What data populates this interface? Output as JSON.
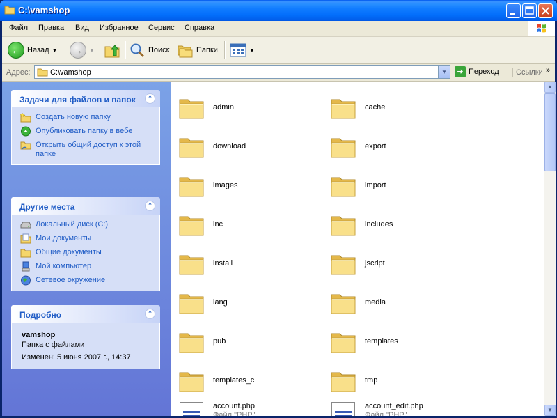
{
  "window": {
    "title": "C:\\vamshop"
  },
  "menu": [
    "Файл",
    "Правка",
    "Вид",
    "Избранное",
    "Сервис",
    "Справка"
  ],
  "toolbar": {
    "back_label": "Назад",
    "search_label": "Поиск",
    "folders_label": "Папки"
  },
  "address": {
    "label": "Адрес:",
    "value": "C:\\vamshop",
    "go_label": "Переход",
    "links_label": "Ссылки"
  },
  "tasks_panel": {
    "title": "Задачи для файлов и папок",
    "items": [
      "Создать новую папку",
      "Опубликовать папку в вебе",
      "Открыть общий доступ к этой папке"
    ]
  },
  "places_panel": {
    "title": "Другие места",
    "items": [
      "Локальный диск (C:)",
      "Мои документы",
      "Общие документы",
      "Мой компьютер",
      "Сетевое окружение"
    ]
  },
  "details_panel": {
    "title": "Подробно",
    "name": "vamshop",
    "type": "Папка с файлами",
    "modified": "Изменен: 5 июня 2007 г., 14:37"
  },
  "folders": [
    "admin",
    "cache",
    "download",
    "export",
    "images",
    "import",
    "inc",
    "includes",
    "install",
    "jscript",
    "lang",
    "media",
    "pub",
    "templates",
    "templates_c",
    "tmp"
  ],
  "files": [
    {
      "name": "account.php",
      "type": "Файл \"PHP\""
    },
    {
      "name": "account_edit.php",
      "type": "Файл \"PHP\""
    }
  ]
}
